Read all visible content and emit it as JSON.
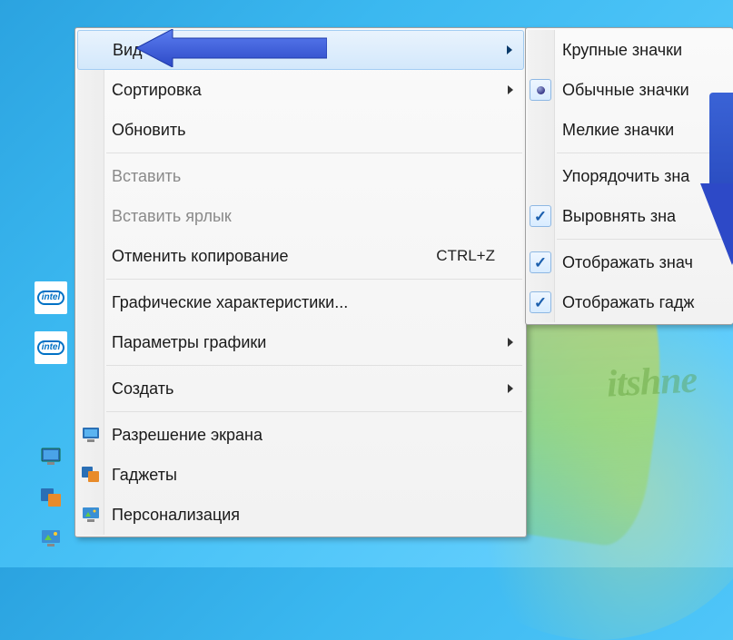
{
  "desktop": {
    "intel_label": "intel",
    "watermark": "itshne"
  },
  "main_menu": {
    "items": [
      {
        "label": "Вид",
        "has_submenu": true,
        "highlighted": true
      },
      {
        "label": "Сортировка",
        "has_submenu": true
      },
      {
        "label": "Обновить"
      },
      {
        "sep": true
      },
      {
        "label": "Вставить",
        "disabled": true
      },
      {
        "label": "Вставить ярлык",
        "disabled": true
      },
      {
        "label": "Отменить копирование",
        "shortcut": "CTRL+Z"
      },
      {
        "sep": true
      },
      {
        "label": "Графические характеристики..."
      },
      {
        "label": "Параметры графики",
        "has_submenu": true
      },
      {
        "sep": true
      },
      {
        "label": "Создать",
        "has_submenu": true
      },
      {
        "sep": true
      },
      {
        "label": "Разрешение экрана",
        "icon": "display-resolution-icon"
      },
      {
        "label": "Гаджеты",
        "icon": "gadgets-icon"
      },
      {
        "label": "Персонализация",
        "icon": "personalization-icon"
      }
    ]
  },
  "sub_menu": {
    "items": [
      {
        "label": "Крупные значки"
      },
      {
        "label": "Обычные значки",
        "radio": true
      },
      {
        "label": "Мелкие значки"
      },
      {
        "sep": true
      },
      {
        "label": "Упорядочить зна"
      },
      {
        "label": "Выровнять зна",
        "checked": true
      },
      {
        "sep": true
      },
      {
        "label": "Отображать знач",
        "checked": true
      },
      {
        "label": "Отображать гадж",
        "checked": true
      }
    ]
  }
}
